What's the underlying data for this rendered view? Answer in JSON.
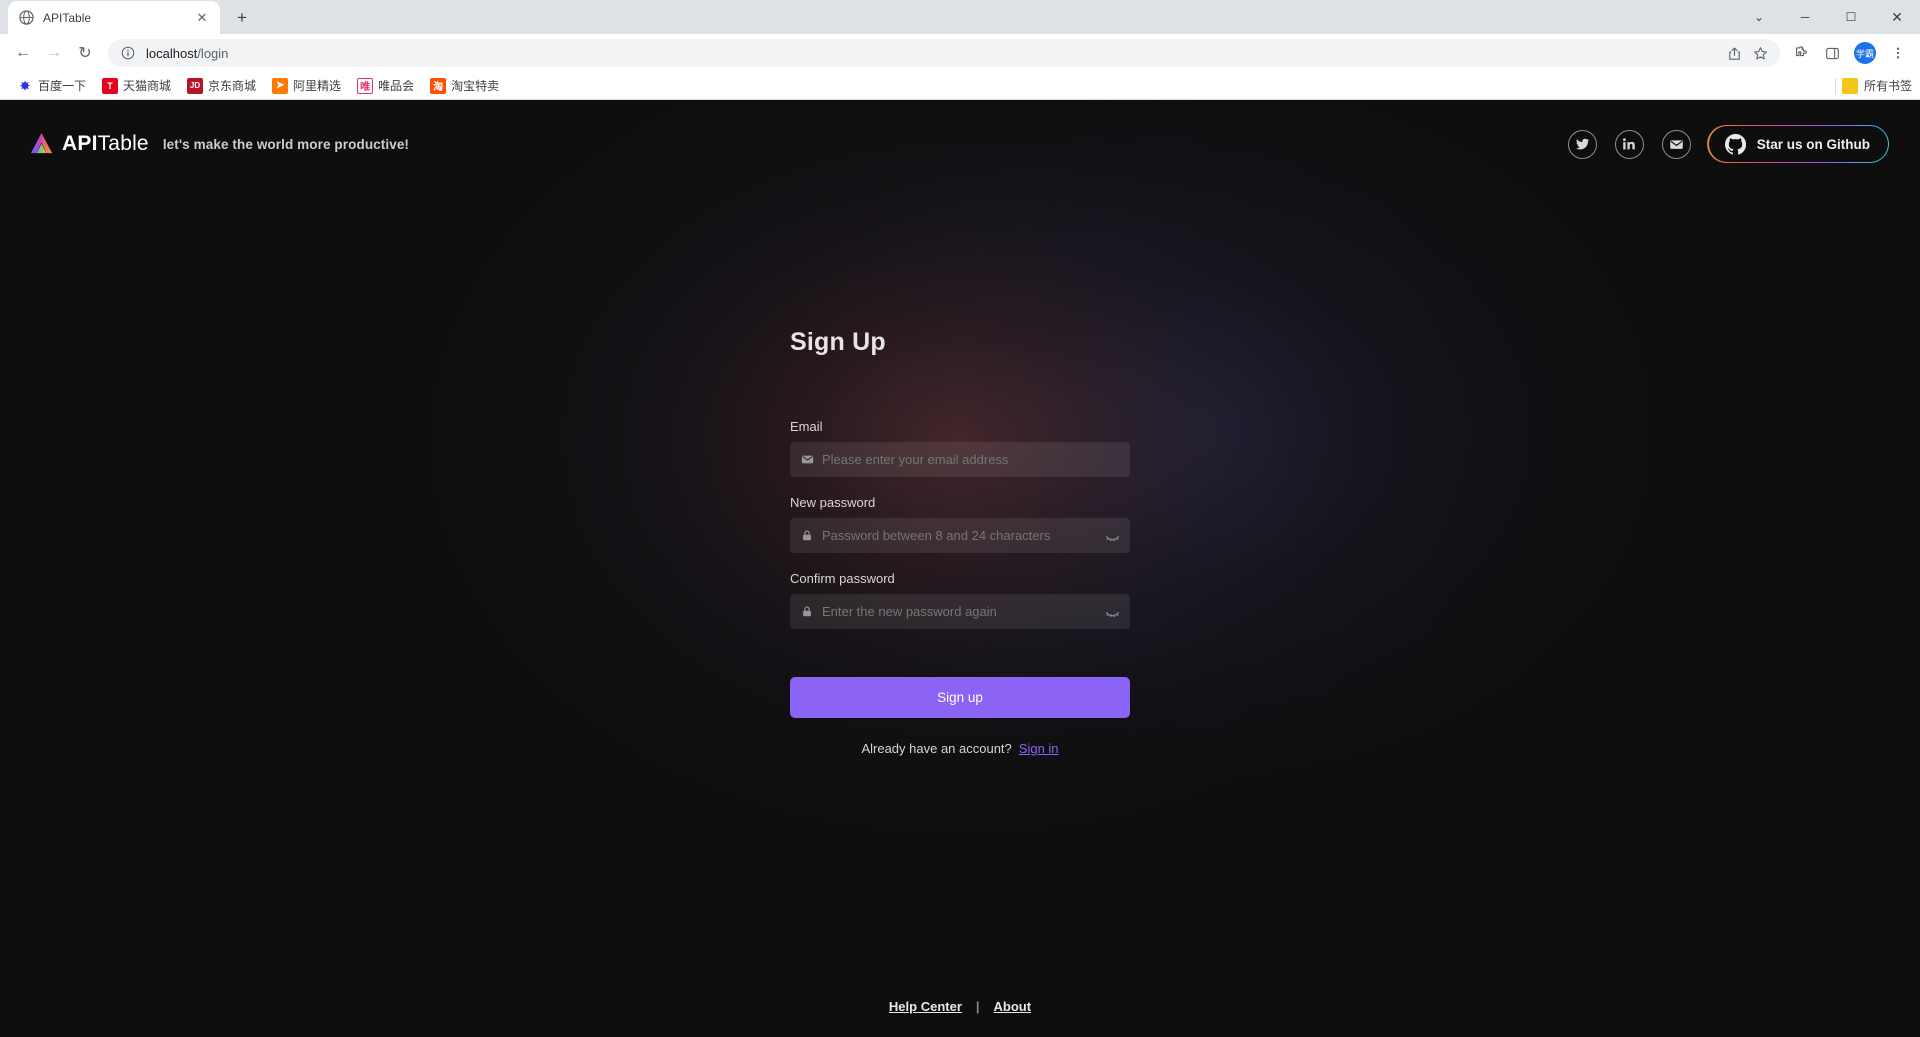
{
  "browser": {
    "tab": {
      "title": "APITable",
      "favicon": "globe-icon",
      "close": "✕"
    },
    "newtab_label": "+",
    "window_controls": {
      "minimize": "─",
      "maximize": "☐",
      "close": "✕",
      "chevron": "⌄"
    },
    "nav": {
      "back": "←",
      "forward": "→",
      "reload": "↻"
    },
    "omnibox": {
      "info_icon": "info-circle-icon",
      "url_host": "localhost",
      "url_path": "/login",
      "share_icon": "share-icon",
      "bookmark_icon": "star-icon"
    },
    "toolbar_right": {
      "extensions_icon": "puzzle-icon",
      "sidepanel_icon": "side-panel-icon",
      "avatar_label": "学霸",
      "menu_icon": "three-dots-icon"
    },
    "bookmarks": [
      {
        "label": "百度一下",
        "icon_text": "✸",
        "icon_bg": "#ffffff",
        "icon_color": "#2932e1"
      },
      {
        "label": "天猫商城",
        "icon_text": "T",
        "icon_bg": "#e8001f",
        "icon_color": "#ffffff"
      },
      {
        "label": "京东商城",
        "icon_text": "JD",
        "icon_bg": "#b91326",
        "icon_color": "#ffffff"
      },
      {
        "label": "阿里精选",
        "icon_text": "➦",
        "icon_bg": "#ff7a00",
        "icon_color": "#ffffff"
      },
      {
        "label": "唯品会",
        "icon_text": "唯",
        "icon_bg": "#ffffff",
        "icon_color": "#e2336b"
      },
      {
        "label": "淘宝特卖",
        "icon_text": "淘",
        "icon_bg": "#ff5000",
        "icon_color": "#ffffff"
      }
    ],
    "bookmarks_all": {
      "label": "所有书签",
      "icon": "folder-icon"
    }
  },
  "site": {
    "brand": {
      "name_bold": "API",
      "name_light": "Table",
      "logo": "apitable-triangle-logo"
    },
    "tagline": "let's make the world more productive!",
    "social": [
      {
        "name": "twitter-icon",
        "label": "Twitter"
      },
      {
        "name": "linkedin-icon",
        "label": "LinkedIn"
      },
      {
        "name": "email-icon",
        "label": "Email"
      }
    ],
    "github_button": {
      "label": "Star us on Github",
      "icon": "github-icon"
    }
  },
  "form": {
    "title": "Sign Up",
    "fields": [
      {
        "label": "Email",
        "placeholder": "Please enter your email address",
        "icon": "envelope-icon",
        "value": "",
        "has_toggle": false
      },
      {
        "label": "New password",
        "placeholder": "Password between 8 and 24 characters",
        "icon": "lock-icon",
        "value": "",
        "has_toggle": true
      },
      {
        "label": "Confirm password",
        "placeholder": "Enter the new password again",
        "icon": "lock-icon",
        "value": "",
        "has_toggle": true
      }
    ],
    "submit_label": "Sign up",
    "signin_prompt": "Already have an account?",
    "signin_link": "Sign in"
  },
  "footer": {
    "help_center": "Help Center",
    "separator": "|",
    "about": "About"
  },
  "colors": {
    "accent_purple": "#8b63f5",
    "page_bg": "#0f0e0f",
    "chrome_tabstrip": "#dee1e6"
  }
}
